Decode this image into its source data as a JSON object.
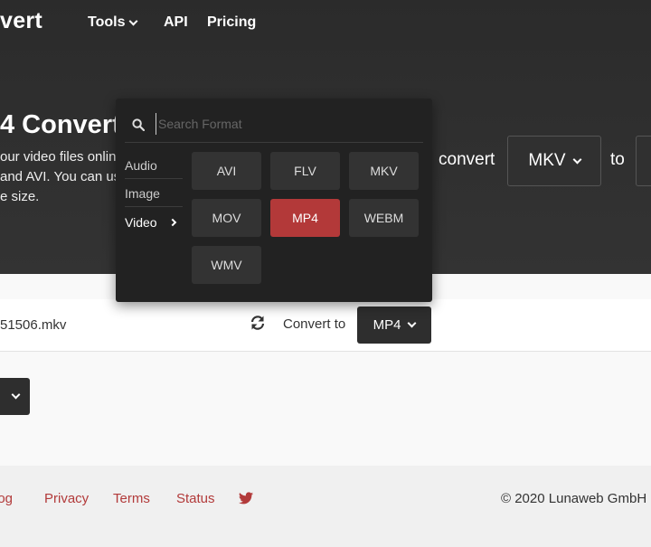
{
  "header": {
    "logo_text": "vert",
    "nav": {
      "tools": "Tools",
      "api": "API",
      "pricing": "Pricing"
    }
  },
  "hero": {
    "title": "4 Convert",
    "description": [
      "our video files onlin",
      "and AVI. You can us",
      "e size."
    ],
    "convert_label": "convert",
    "from_format": "MKV",
    "to_label": "to"
  },
  "dropdown": {
    "search_placeholder": "Search Format",
    "categories": [
      "Audio",
      "Image",
      "Video"
    ],
    "selected_category": "Video",
    "formats": [
      "AVI",
      "FLV",
      "MKV",
      "MOV",
      "MP4",
      "WEBM",
      "WMV"
    ],
    "selected_format": "MP4"
  },
  "file": {
    "name": "51506.mkv",
    "convert_to_label": "Convert to",
    "target_format": "MP4"
  },
  "footer": {
    "links": {
      "blog": "log",
      "privacy": "Privacy",
      "terms": "Terms",
      "status": "Status"
    },
    "copyright": "© 2020 Lunaweb GmbH"
  },
  "colors": {
    "accent": "#b33939",
    "link": "#b23a3a",
    "dark_bg": "#222222"
  },
  "icons": {
    "search": "search-icon",
    "refresh": "refresh-icon",
    "twitter": "twitter-icon",
    "chevron": "chevron-down-icon"
  }
}
